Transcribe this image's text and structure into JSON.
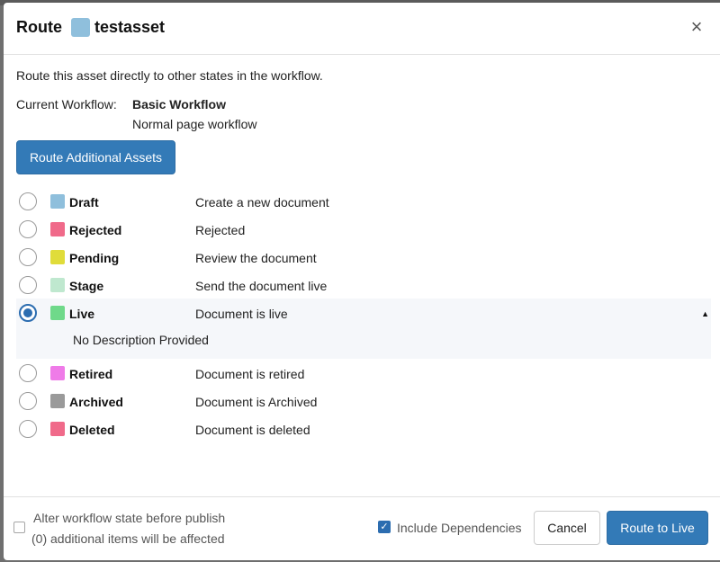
{
  "dialog": {
    "title_prefix": "Route",
    "asset_name": "testasset",
    "asset_color": "#8fbfdc",
    "close_glyph": "×"
  },
  "body": {
    "intro": "Route this asset directly to other states in the workflow.",
    "current_workflow_label": "Current Workflow:",
    "workflow_name": "Basic Workflow",
    "workflow_description": "Normal page workflow",
    "route_additional_label": "Route Additional Assets"
  },
  "states": [
    {
      "name": "Draft",
      "description": "Create a new document",
      "color": "#8fbfdc",
      "selected": false
    },
    {
      "name": "Rejected",
      "description": "Rejected",
      "color": "#f06a8a",
      "selected": false
    },
    {
      "name": "Pending",
      "description": "Review the document",
      "color": "#e0dc3a",
      "selected": false
    },
    {
      "name": "Stage",
      "description": "Send the document live",
      "color": "#bfe8cf",
      "selected": false
    },
    {
      "name": "Live",
      "description": "Document is live",
      "color": "#6fd98a",
      "selected": true,
      "detail": "No Description Provided"
    },
    {
      "name": "Retired",
      "description": "Document is retired",
      "color": "#ef7be8",
      "selected": false
    },
    {
      "name": "Archived",
      "description": "Document is Archived",
      "color": "#9a9a9a",
      "selected": false
    },
    {
      "name": "Deleted",
      "description": "Document is deleted",
      "color": "#f06a8a",
      "selected": false
    }
  ],
  "footer": {
    "alter_label": "Alter workflow state before publish",
    "affected_label": "(0) additional items will be affected",
    "include_deps_label": "Include Dependencies",
    "include_deps_checked": true,
    "cancel_label": "Cancel",
    "route_live_label": "Route to Live"
  },
  "colors": {
    "primary": "#337ab7",
    "radio_selected": "#2c6db0"
  }
}
